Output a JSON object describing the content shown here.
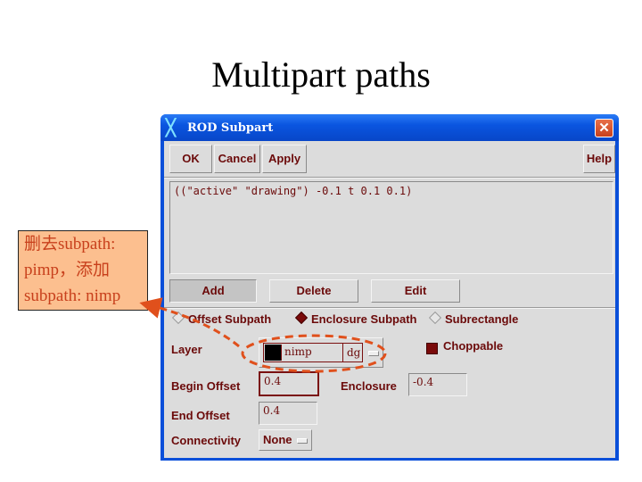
{
  "slide": {
    "title": "Multipart paths"
  },
  "callout": {
    "lines": [
      "删去subpath:",
      "pimp，添加",
      "subpath: nimp"
    ]
  },
  "window": {
    "title": "ROD Subpart",
    "title_icon": "x-logo-icon",
    "close_glyph": "✕"
  },
  "toolbar": {
    "ok": "OK",
    "cancel": "Cancel",
    "apply": "Apply",
    "help": "Help"
  },
  "subpart_list": {
    "text": "((\"active\" \"drawing\") -0.1 t 0.1 0.1)"
  },
  "actions": {
    "add": "Add",
    "delete": "Delete",
    "edit": "Edit"
  },
  "subpath_type": {
    "options": [
      "Offset Subpath",
      "Enclosure Subpath",
      "Subrectangle"
    ],
    "selected": "Enclosure Subpath"
  },
  "form": {
    "layer_label": "Layer",
    "layer_name": "nimp",
    "layer_purpose": "dg",
    "choppable_label": "Choppable",
    "choppable_checked": true,
    "begin_offset_label": "Begin Offset",
    "begin_offset": "0.4",
    "enclosure_label": "Enclosure",
    "enclosure": "-0.4",
    "end_offset_label": "End Offset",
    "end_offset": "0.4",
    "connectivity_label": "Connectivity",
    "connectivity": "None"
  },
  "colors": {
    "accent_text": "#6b0a0a",
    "titlebar": "#0a55e0",
    "callout_bg": "#fcbf8f",
    "annotation": "#e0501c"
  }
}
